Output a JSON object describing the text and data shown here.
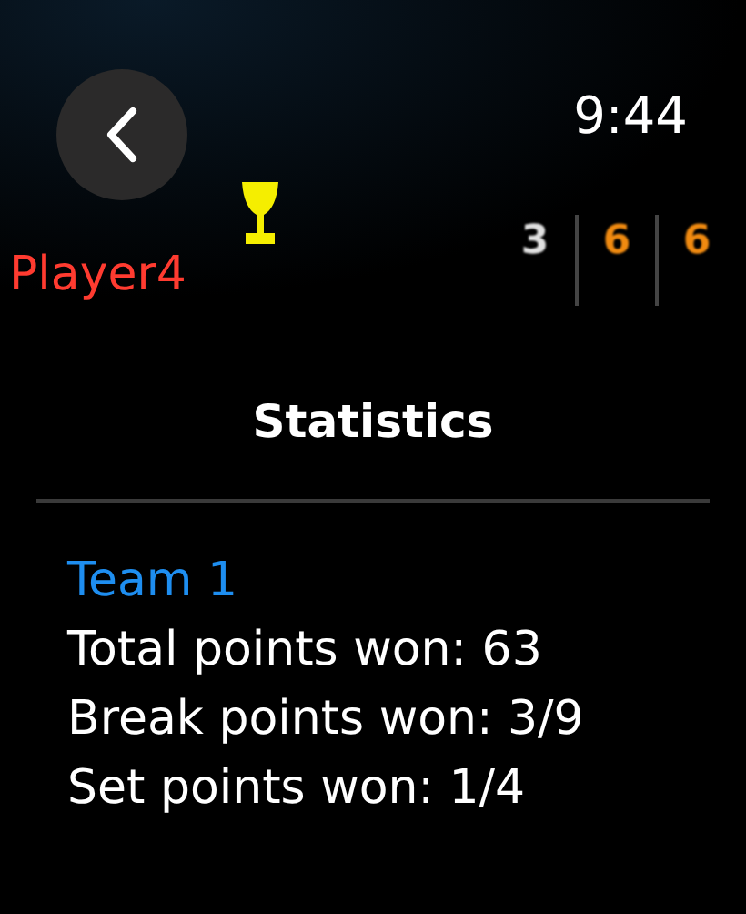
{
  "status_bar": {
    "time": "9:44"
  },
  "scoreboard": {
    "player": "Player4",
    "scores": [
      {
        "value": "3",
        "color": "#e0e0e0"
      },
      {
        "value": "6",
        "color": "#f08a10"
      },
      {
        "value": "6",
        "color": "#f08a10"
      }
    ]
  },
  "title": "Statistics",
  "team": {
    "name": "Team 1",
    "stats": [
      "Total points won: 63",
      "Break points won: 3/9",
      "Set points won: 1/4"
    ]
  }
}
